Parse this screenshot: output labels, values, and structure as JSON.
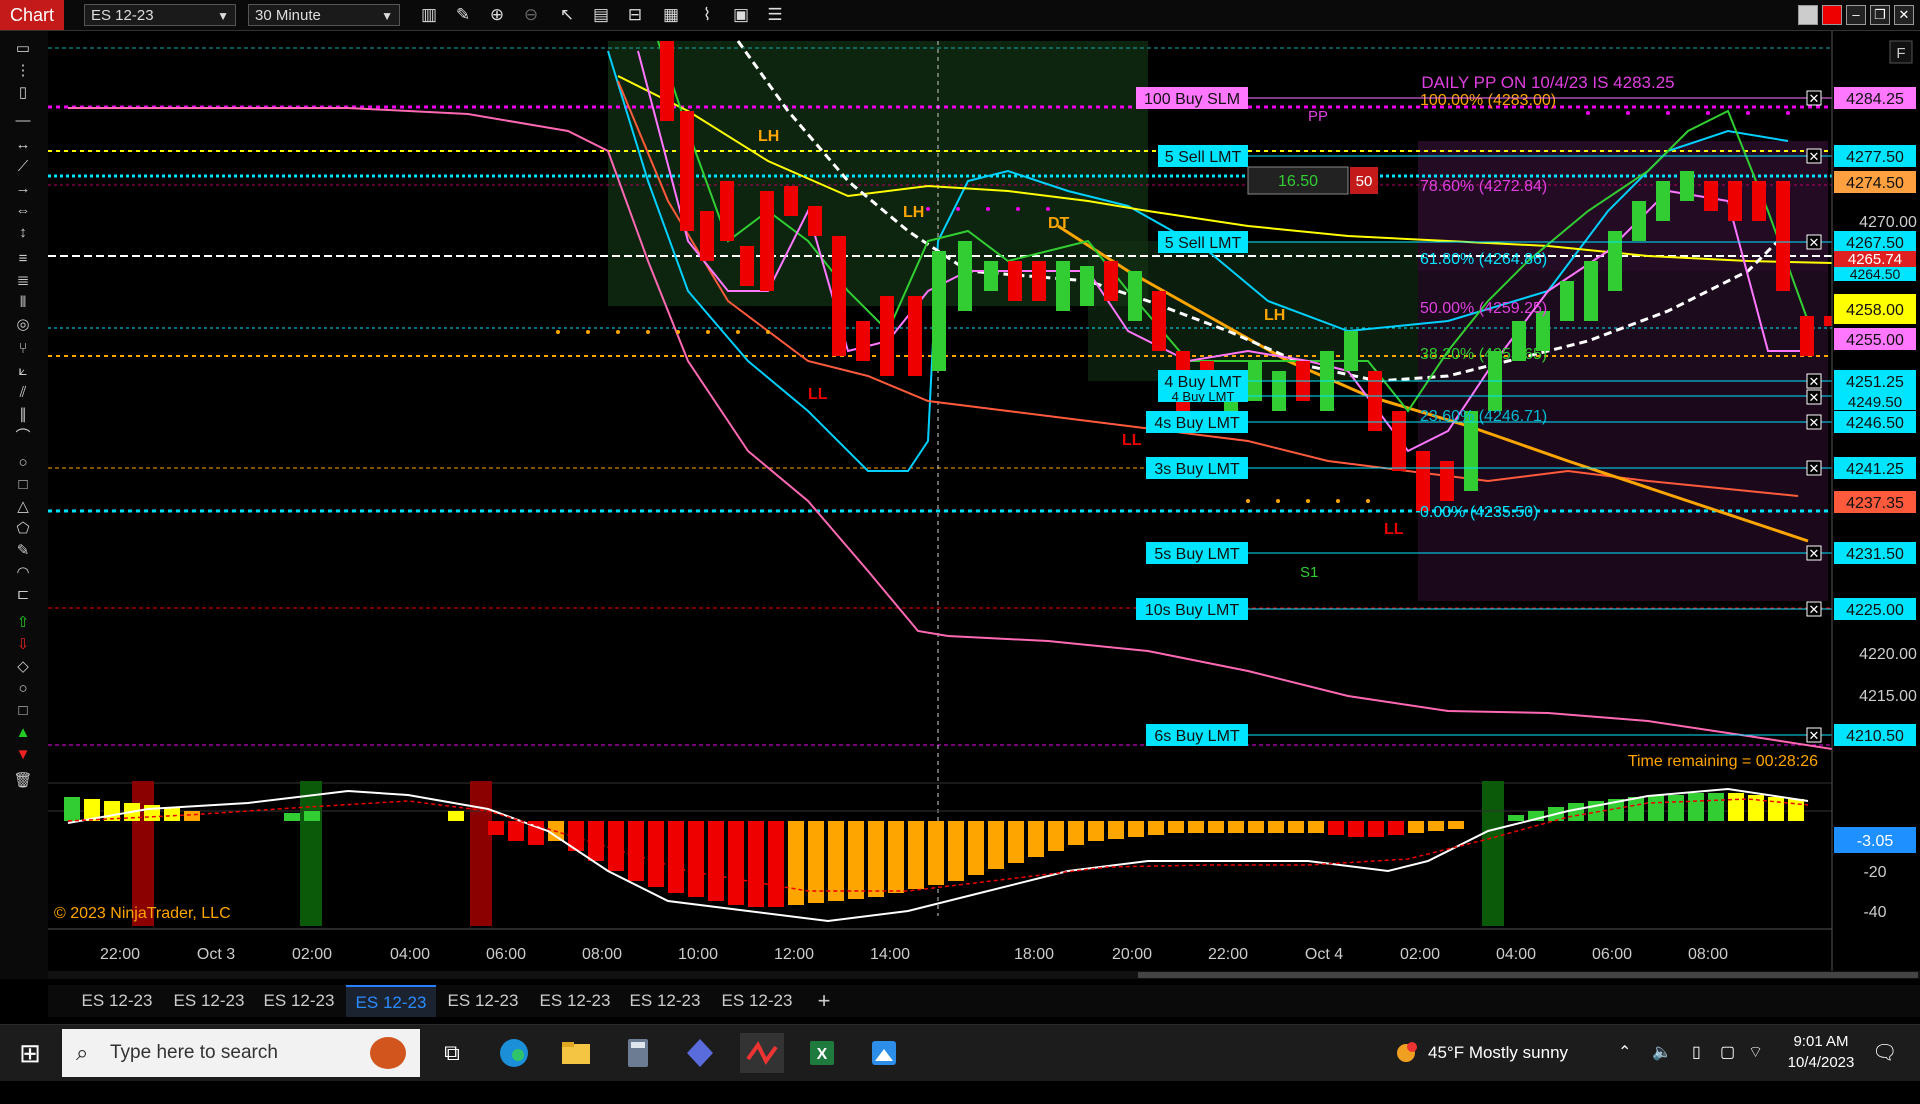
{
  "window": {
    "title": "Chart",
    "instrument": "ES 12-23",
    "interval": "30 Minute",
    "f_button": "F"
  },
  "chart": {
    "price_axis_labels": [
      "4270.00",
      "4220.00",
      "4215.00"
    ],
    "time_labels": [
      "22:00",
      "Oct 3",
      "02:00",
      "04:00",
      "06:00",
      "08:00",
      "10:00",
      "12:00",
      "14:00",
      "18:00",
      "20:00",
      "22:00",
      "Oct 4",
      "02:00",
      "04:00",
      "06:00",
      "08:00"
    ],
    "pivot_title": "DAILY PP ON 10/4/23 IS 4283.25",
    "pp_label": "PP",
    "s1_label": "S1",
    "fib_labels": [
      "100.00% (4283.00)",
      "78.60% (4272.84)",
      "61.80% (4264.86)",
      "50.00% (4259.25)",
      "38.20% (4253.65)",
      "23.60% (4246.71)",
      "0.00% (4235.50)"
    ],
    "swing_labels": [
      "LH",
      "LH",
      "DT",
      "LH",
      "LL",
      "LL",
      "LL"
    ],
    "orders": [
      {
        "label": "100 Buy SLM",
        "price": "4284.25",
        "color": "#ff77ff"
      },
      {
        "label": "5 Sell LMT",
        "price": "4277.50",
        "color": "#00e5ff"
      },
      {
        "label": "5 Sell LMT",
        "price": "4267.50",
        "color": "#00e5ff"
      },
      {
        "label": "4 Buy LMT",
        "price": "4251.25",
        "color": "#00e5ff"
      },
      {
        "label": "4 Buy LMT",
        "price": "4249.50",
        "color": "#00e5ff"
      },
      {
        "label": "4s Buy LMT",
        "price": "4246.50",
        "color": "#00e5ff"
      },
      {
        "label": "3s Buy LMT",
        "price": "4241.25",
        "color": "#00e5ff"
      },
      {
        "label": "5s Buy LMT",
        "price": "4231.50",
        "color": "#00e5ff"
      },
      {
        "label": "10s Buy LMT",
        "price": "4225.00",
        "color": "#00e5ff"
      },
      {
        "label": "6s Buy LMT",
        "price": "4210.50",
        "color": "#00e5ff"
      }
    ],
    "price_boxes": [
      {
        "price": "4274.50",
        "color": "#ffa040"
      },
      {
        "price": "4265.74",
        "color": "#e02020"
      },
      {
        "price": "4264.50",
        "color": "#00e5ff"
      },
      {
        "price": "4258.00",
        "color": "#ffff00"
      },
      {
        "price": "4255.00",
        "color": "#ff77ff"
      },
      {
        "price": "4237.35",
        "color": "#ff5a3c"
      }
    ],
    "qty_box": {
      "value": "16.50",
      "count": "50"
    },
    "time_remaining": "Time remaining = 00:28:26",
    "osc_axis": [
      "-20",
      "-40"
    ],
    "osc_value": "-3.05",
    "copyright": "© 2023 NinjaTrader, LLC"
  },
  "tabs": [
    "ES 12-23",
    "ES 12-23",
    "ES 12-23",
    "ES 12-23",
    "ES 12-23",
    "ES 12-23",
    "ES 12-23",
    "ES 12-23"
  ],
  "taskbar": {
    "search_placeholder": "Type here to search",
    "weather": "45°F  Mostly sunny",
    "time": "9:01 AM",
    "date": "10/4/2023"
  }
}
